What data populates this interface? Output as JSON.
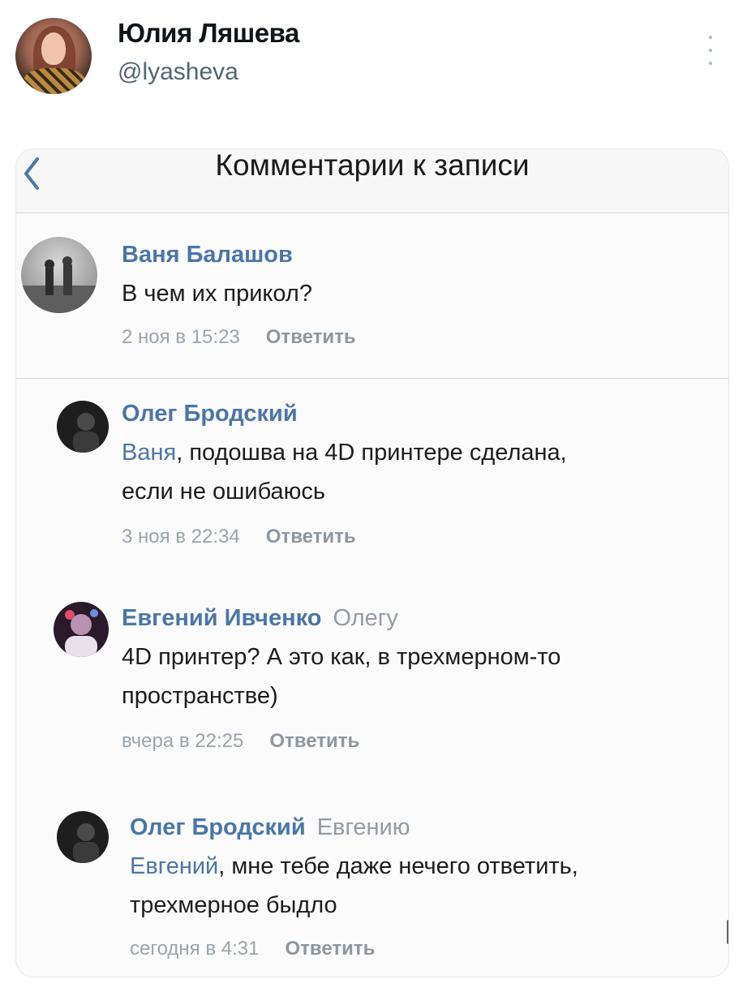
{
  "tweet": {
    "author_name": "Юлия Ляшева",
    "author_handle": "@lyasheva",
    "avatar_icon": "user-avatar",
    "more_icon": "more-vertical-icon"
  },
  "screenshot": {
    "nav": {
      "title": "Комментарии к записи",
      "back_icon": "chevron-left-icon"
    },
    "comments": [
      {
        "author": "Ваня Балашов",
        "reply_to": "",
        "mention": "",
        "text_line1": "В чем их прикол?",
        "text_line2": "",
        "time": "2 ноя в 15:23",
        "reply_label": "Ответить"
      },
      {
        "author": "Олег Бродский",
        "reply_to": "",
        "mention": "Ваня",
        "text_line1": ", подошва на 4D принтере сделана,",
        "text_line2": "если не ошибаюсь",
        "time": "3 ноя в 22:34",
        "reply_label": "Ответить"
      },
      {
        "author": "Евгений Ивченко",
        "reply_to": "Олегу",
        "mention": "",
        "text_line1": "4D принтер? А это как, в трехмерном-то",
        "text_line2": "пространстве)",
        "time": "вчера в 22:25",
        "reply_label": "Ответить"
      },
      {
        "author": "Олег Бродский",
        "reply_to": "Евгению",
        "mention": "Евгений",
        "text_line1": ", мне тебе даже нечего ответить,",
        "text_line2": "трехмерное быдло",
        "time": "сегодня в 4:31",
        "reply_label": "Ответить"
      }
    ]
  },
  "colors": {
    "link": "#4a76a8",
    "meta": "#9ba3ac",
    "handle": "#536471"
  }
}
